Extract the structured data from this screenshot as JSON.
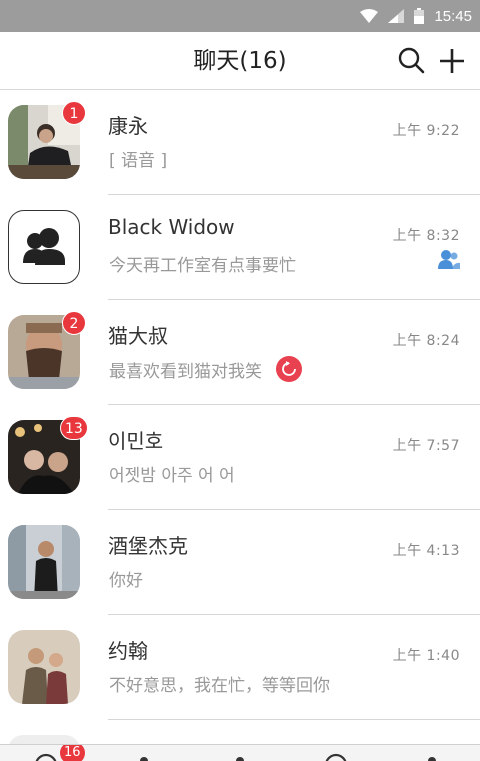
{
  "status_bar": {
    "time": "15:45",
    "icons": [
      "wifi-icon",
      "signal-icon",
      "battery-icon"
    ]
  },
  "header": {
    "title": "聊天(16)",
    "actions": [
      "search-icon",
      "plus-icon"
    ]
  },
  "chats": [
    {
      "name": "康永",
      "message": "[ 语音 ]",
      "time": "上午 9:22",
      "badge": "1"
    },
    {
      "name": "Black Widow",
      "message": "今天再工作室有点事要忙",
      "time": "上午 8:32",
      "badge": "",
      "group": true
    },
    {
      "name": "猫大叔",
      "message": "最喜欢看到猫对我笑",
      "time": "上午 8:24",
      "badge": "2",
      "failed": true
    },
    {
      "name": "이민호",
      "message": "어젯밤 아주 어 어",
      "time": "上午 7:57",
      "badge": "13"
    },
    {
      "name": "酒堡杰克",
      "message": "你好",
      "time": "上午 4:13",
      "badge": ""
    },
    {
      "name": "约翰",
      "message": "不好意思，我在忙，等等回你",
      "time": "上午 1:40",
      "badge": ""
    }
  ],
  "tab_bar": {
    "badge": "16"
  },
  "colors": {
    "accent_red": "#e8383d",
    "status_bar": "#9c9c9c",
    "group_blue": "#4a90d9"
  }
}
